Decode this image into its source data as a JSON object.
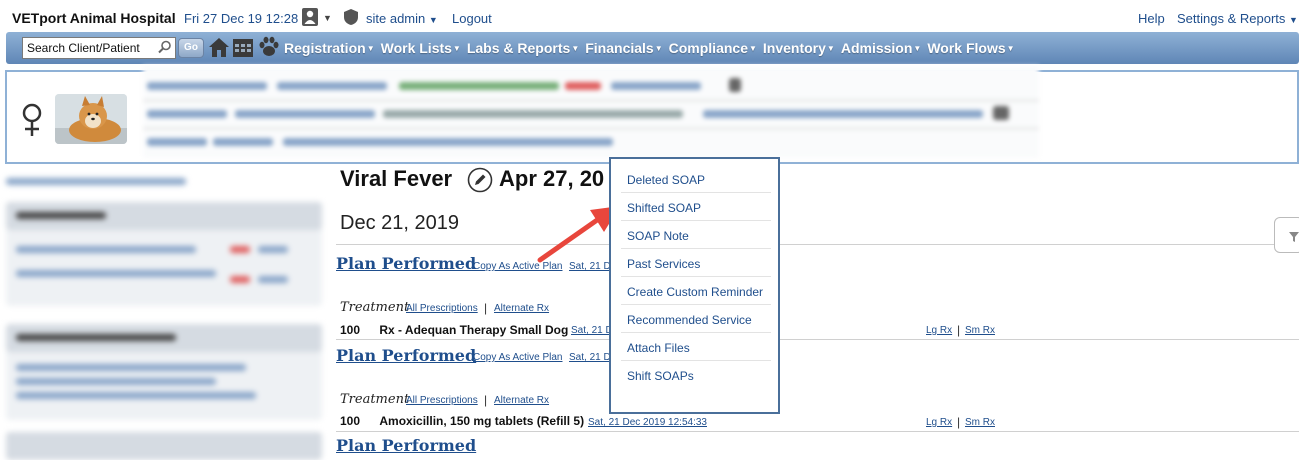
{
  "topbar": {
    "brand": "VETport Animal Hospital",
    "datetime": "Fri 27 Dec 19 12:28",
    "username": "site admin",
    "logout": "Logout",
    "help": "Help",
    "settings": "Settings & Reports"
  },
  "navbar": {
    "search_value": "Search Client/Patient",
    "go_label": "Go",
    "items": [
      {
        "label": "Registration"
      },
      {
        "label": "Work Lists"
      },
      {
        "label": "Labs & Reports"
      },
      {
        "label": "Financials"
      },
      {
        "label": "Compliance"
      },
      {
        "label": "Inventory"
      },
      {
        "label": "Admission"
      },
      {
        "label": "Work Flows"
      }
    ]
  },
  "main": {
    "title": "Viral Fever",
    "title_date": "Apr 27, 20",
    "date_heading": "Dec 21, 2019",
    "plans": [
      {
        "title": "Plan Performed",
        "copy_link": "Copy As Active Plan",
        "date": "Sat, 21 D",
        "treatment_label": "Treatment",
        "all_rx": "All Prescriptions",
        "sep": "|",
        "alt_rx": "Alternate Rx",
        "qty": "100",
        "rx_name": "Rx - Adequan Therapy Small Dog",
        "rx_date": "Sat, 21 D",
        "lg_rx": "Lg Rx",
        "sm_rx": "Sm Rx"
      },
      {
        "title": "Plan Performed",
        "copy_link": "Copy As Active Plan",
        "date": "Sat, 21 D",
        "treatment_label": "Treatment",
        "all_rx": "All Prescriptions",
        "sep": "|",
        "alt_rx": "Alternate Rx",
        "qty": "100",
        "rx_name": "Amoxicillin, 150 mg tablets (Refill 5)",
        "rx_date": "Sat, 21 Dec 2019 12:54:33",
        "lg_rx": "Lg Rx",
        "sm_rx": "Sm Rx"
      }
    ],
    "third_plan_partial": "Plan Performed"
  },
  "menu": {
    "items": [
      "Deleted SOAP",
      "Shifted SOAP",
      "SOAP Note",
      "Past Services",
      "Create Custom Reminder",
      "Recommended Service",
      "Attach Files",
      "Shift SOAPs"
    ]
  },
  "colors": {
    "nav_top": "#8fb1d6",
    "nav_bottom": "#5f86b6",
    "link": "#1f4e8c",
    "arrow": "#e8463c",
    "menu_border": "#4a6f9a"
  }
}
